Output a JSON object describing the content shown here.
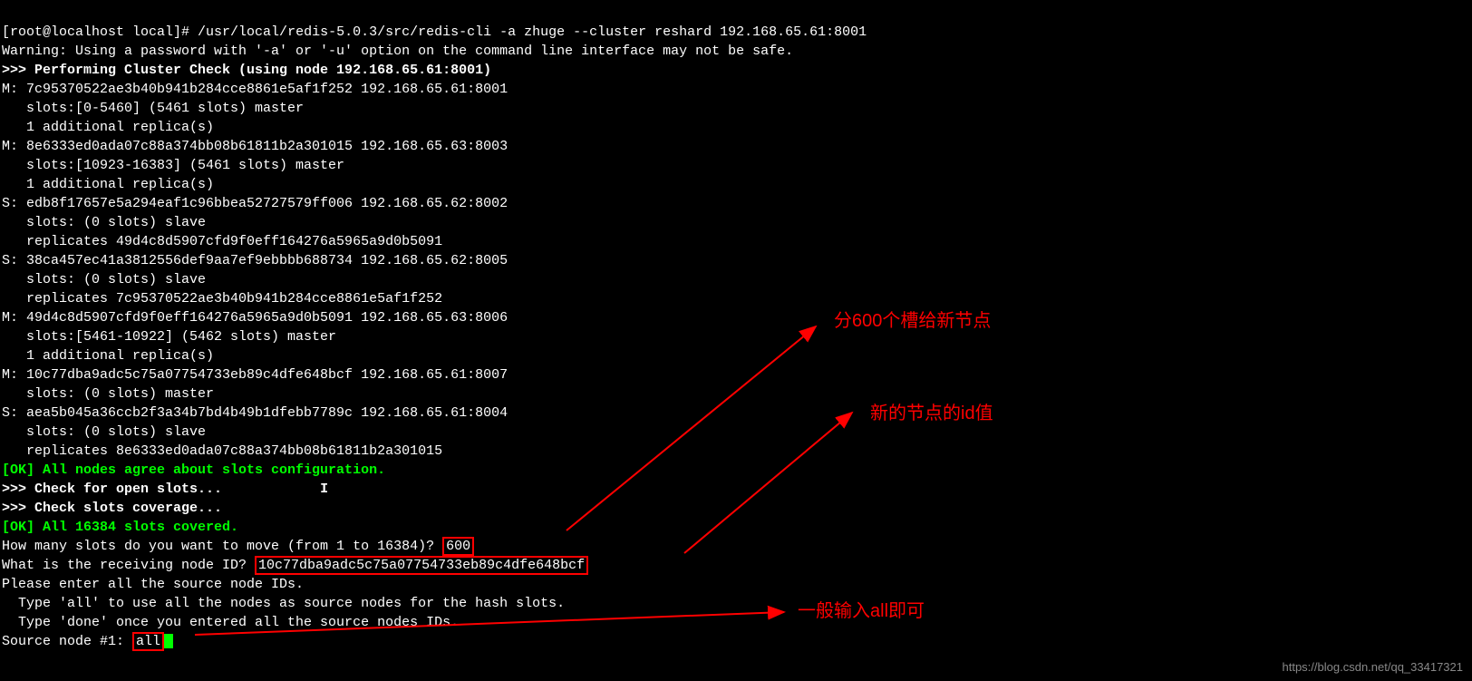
{
  "prompt": "[root@localhost local]# ",
  "command": "/usr/local/redis-5.0.3/src/redis-cli -a zhuge --cluster reshard 192.168.65.61:8001",
  "warning": "Warning: Using a password with '-a' or '-u' option on the command line interface may not be safe.",
  "performing": ">>> Performing Cluster Check (using node 192.168.65.61:8001)",
  "nodes": {
    "m1": {
      "l1": "M: 7c95370522ae3b40b941b284cce8861e5af1f252 192.168.65.61:8001",
      "l2": "   slots:[0-5460] (5461 slots) master",
      "l3": "   1 additional replica(s)"
    },
    "m2": {
      "l1": "M: 8e6333ed0ada07c88a374bb08b61811b2a301015 192.168.65.63:8003",
      "l2": "   slots:[10923-16383] (5461 slots) master",
      "l3": "   1 additional replica(s)"
    },
    "s1": {
      "l1": "S: edb8f17657e5a294eaf1c96bbea52727579ff006 192.168.65.62:8002",
      "l2": "   slots: (0 slots) slave",
      "l3": "   replicates 49d4c8d5907cfd9f0eff164276a5965a9d0b5091"
    },
    "s2": {
      "l1": "S: 38ca457ec41a3812556def9aa7ef9ebbbb688734 192.168.65.62:8005",
      "l2": "   slots: (0 slots) slave",
      "l3": "   replicates 7c95370522ae3b40b941b284cce8861e5af1f252"
    },
    "m3": {
      "l1": "M: 49d4c8d5907cfd9f0eff164276a5965a9d0b5091 192.168.65.63:8006",
      "l2": "   slots:[5461-10922] (5462 slots) master",
      "l3": "   1 additional replica(s)"
    },
    "m4": {
      "l1": "M: 10c77dba9adc5c75a07754733eb89c4dfe648bcf 192.168.65.61:8007",
      "l2": "   slots: (0 slots) master"
    },
    "s3": {
      "l1": "S: aea5b045a36ccb2f3a34b7bd4b49b1dfebb7789c 192.168.65.61:8004",
      "l2": "   slots: (0 slots) slave",
      "l3": "   replicates 8e6333ed0ada07c88a374bb08b61811b2a301015"
    }
  },
  "ok1": "[OK] All nodes agree about slots configuration.",
  "check_open": ">>> Check for open slots...",
  "check_cov": ">>> Check slots coverage...",
  "ok2": "[OK] All 16384 slots covered.",
  "q_slots": "How many slots do you want to move (from 1 to 16384)? ",
  "a_slots": "600",
  "q_recv": "What is the receiving node ID? ",
  "a_recv": "10c77dba9adc5c75a07754733eb89c4dfe648bcf",
  "src_intro": "Please enter all the source node IDs.",
  "src_all": "  Type 'all' to use all the nodes as source nodes for the hash slots.",
  "src_done": "  Type 'done' once you entered all the source nodes IDs.",
  "src_prompt": "Source node #1: ",
  "src_input": "all",
  "annotations": {
    "a1": "分600个槽给新节点",
    "a2": "新的节点的id值",
    "a3": "一般输入all即可"
  },
  "watermark": "https://blog.csdn.net/qq_33417321"
}
